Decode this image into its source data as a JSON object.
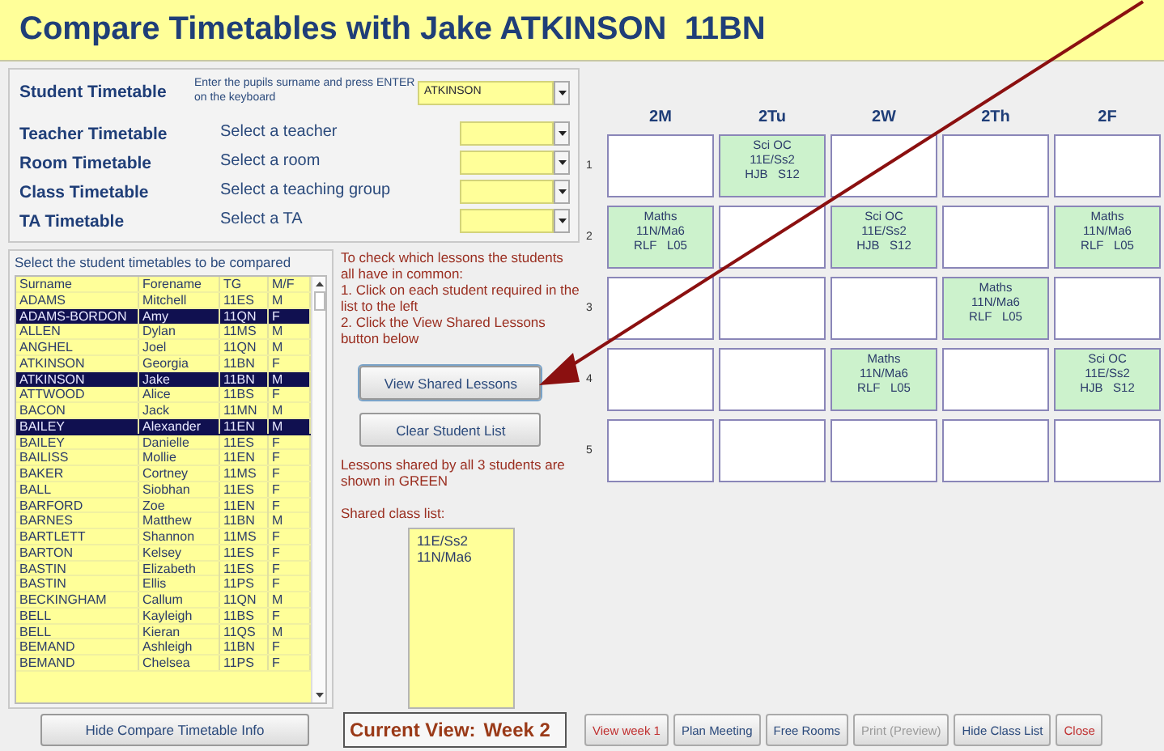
{
  "title": "Compare Timetables with Jake ATKINSON  11BN",
  "selectors": [
    {
      "label": "Student Timetable",
      "hint": "Enter the pupils surname and press ENTER on the keyboard",
      "value": "ATKINSON",
      "kind": "small"
    },
    {
      "label": "Teacher Timetable",
      "hint": "Select a teacher",
      "kind": "normal"
    },
    {
      "label": "Room Timetable",
      "hint": "Select a room",
      "kind": "normal"
    },
    {
      "label": "Class Timetable",
      "hint": "Select a teaching group",
      "kind": "normal"
    },
    {
      "label": "TA Timetable",
      "hint": "Select a TA",
      "kind": "normal"
    }
  ],
  "student_list": {
    "caption": "Select the student timetables to be compared",
    "columns": [
      "Surname",
      "Forename",
      "TG",
      "M/F"
    ],
    "rows": [
      {
        "cells": [
          "ADAMS",
          "Mitchell",
          "11ES",
          "M"
        ],
        "selected": false
      },
      {
        "cells": [
          "ADAMS-BORDON",
          "Amy",
          "11QN",
          "F"
        ],
        "selected": true
      },
      {
        "cells": [
          "ALLEN",
          "Dylan",
          "11MS",
          "M"
        ],
        "selected": false
      },
      {
        "cells": [
          "ANGHEL",
          "Joel",
          "11QN",
          "M"
        ],
        "selected": false
      },
      {
        "cells": [
          "ATKINSON",
          "Georgia",
          "11BN",
          "F"
        ],
        "selected": false
      },
      {
        "cells": [
          "ATKINSON",
          "Jake",
          "11BN",
          "M"
        ],
        "selected": true
      },
      {
        "cells": [
          "ATTWOOD",
          "Alice",
          "11BS",
          "F"
        ],
        "selected": false
      },
      {
        "cells": [
          "BACON",
          "Jack",
          "11MN",
          "M"
        ],
        "selected": false
      },
      {
        "cells": [
          "BAILEY",
          "Alexander",
          "11EN",
          "M"
        ],
        "selected": true
      },
      {
        "cells": [
          "BAILEY",
          "Danielle",
          "11ES",
          "F"
        ],
        "selected": false
      },
      {
        "cells": [
          "BAILISS",
          "Mollie",
          "11EN",
          "F"
        ],
        "selected": false
      },
      {
        "cells": [
          "BAKER",
          "Cortney",
          "11MS",
          "F"
        ],
        "selected": false
      },
      {
        "cells": [
          "BALL",
          "Siobhan",
          "11ES",
          "F"
        ],
        "selected": false
      },
      {
        "cells": [
          "BARFORD",
          "Zoe",
          "11EN",
          "F"
        ],
        "selected": false
      },
      {
        "cells": [
          "BARNES",
          "Matthew",
          "11BN",
          "M"
        ],
        "selected": false
      },
      {
        "cells": [
          "BARTLETT",
          "Shannon",
          "11MS",
          "F"
        ],
        "selected": false
      },
      {
        "cells": [
          "BARTON",
          "Kelsey",
          "11ES",
          "F"
        ],
        "selected": false
      },
      {
        "cells": [
          "BASTIN",
          "Elizabeth",
          "11ES",
          "F"
        ],
        "selected": false
      },
      {
        "cells": [
          "BASTIN",
          "Ellis",
          "11PS",
          "F"
        ],
        "selected": false
      },
      {
        "cells": [
          "BECKINGHAM",
          "Callum",
          "11QN",
          "M"
        ],
        "selected": false
      },
      {
        "cells": [
          "BELL",
          "Kayleigh",
          "11BS",
          "F"
        ],
        "selected": false
      },
      {
        "cells": [
          "BELL",
          "Kieran",
          "11QS",
          "M"
        ],
        "selected": false
      },
      {
        "cells": [
          "BEMAND",
          "Ashleigh",
          "11BN",
          "F"
        ],
        "selected": false
      },
      {
        "cells": [
          "BEMAND",
          "Chelsea",
          "11PS",
          "F"
        ],
        "selected": false
      }
    ]
  },
  "instructions": [
    "To check which lessons the students all have in common:",
    "1. Click on each student required in the list to the left",
    "2. Click the View Shared Lessons button below"
  ],
  "action_buttons": [
    "View Shared Lessons",
    "Clear Student List"
  ],
  "shared_note": "Lessons shared by all 3 students are shown in GREEN",
  "shared_class_list": {
    "label": "Shared class list:",
    "items": [
      "11E/Ss2",
      "11N/Ma6"
    ]
  },
  "timetable": {
    "days": [
      "2M",
      "2Tu",
      "2W",
      "2Th",
      "2F"
    ],
    "periods": [
      {
        "label": "1",
        "cells": [
          null,
          [
            "Sci OC",
            "11E/Ss2",
            "HJB   S12"
          ],
          null,
          null,
          null
        ]
      },
      {
        "label": "2",
        "cells": [
          [
            "Maths",
            "11N/Ma6",
            "RLF   L05"
          ],
          null,
          [
            "Sci OC",
            "11E/Ss2",
            "HJB   S12"
          ],
          null,
          [
            "Maths",
            "11N/Ma6",
            "RLF   L05"
          ]
        ]
      },
      {
        "label": "3",
        "cells": [
          null,
          null,
          null,
          [
            "Maths",
            "11N/Ma6",
            "RLF   L05"
          ],
          null
        ]
      },
      {
        "label": "4",
        "cells": [
          null,
          null,
          [
            "Maths",
            "11N/Ma6",
            "RLF   L05"
          ],
          null,
          [
            "Sci OC",
            "11E/Ss2",
            "HJB   S12"
          ]
        ]
      },
      {
        "label": "5",
        "cells": [
          null,
          null,
          null,
          null,
          null
        ]
      }
    ]
  },
  "hide_info_button": "Hide Compare Timetable Info",
  "current_view": {
    "label": "Current View:",
    "value": "Week 2"
  },
  "footer_buttons": [
    {
      "label": "View week 1",
      "kind": "alert",
      "disabled": false
    },
    {
      "label": "Plan Meeting",
      "kind": "normal",
      "disabled": false
    },
    {
      "label": "Free Rooms",
      "kind": "normal",
      "disabled": false
    },
    {
      "label": "Print (Preview)",
      "kind": "normal",
      "disabled": true
    },
    {
      "label": "Hide Class List",
      "kind": "normal",
      "disabled": false
    },
    {
      "label": "Close",
      "kind": "alert",
      "disabled": false
    }
  ]
}
